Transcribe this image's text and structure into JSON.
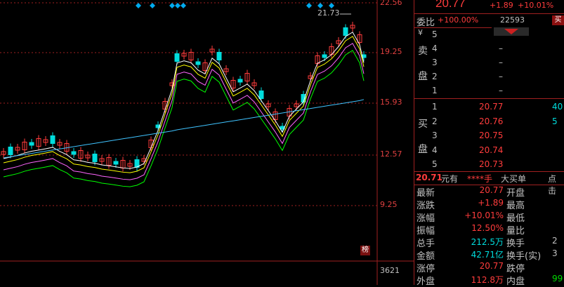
{
  "chart": {
    "price_axis": [
      "22.56",
      "19.25",
      "15.93",
      "12.57",
      "9.25"
    ],
    "volume_axis": "3621",
    "high_annotation": "21.73",
    "rank_badge": "榜",
    "colors": {
      "up": "#ff3c3c",
      "down": "#00dddd",
      "grid": "#a02020",
      "ma5": "#ffffff",
      "ma10": "#ffff00",
      "ma20": "#ff66ff",
      "ma30": "#00ff00",
      "ma60": "#3fc3ff"
    }
  },
  "top": {
    "price": "20.77",
    "change": "+1.89",
    "pct": "+10.01%"
  },
  "webi": {
    "label": "委比",
    "pct": "+100.00%",
    "diff": "22593",
    "sell_button": "买"
  },
  "sell_side": {
    "label1": "卖",
    "label2": "盘",
    "currency": "¥",
    "levels": [
      {
        "level": "5",
        "price": "",
        "vol": ""
      },
      {
        "level": "4",
        "price": "–",
        "vol": ""
      },
      {
        "level": "3",
        "price": "–",
        "vol": ""
      },
      {
        "level": "2",
        "price": "–",
        "vol": ""
      },
      {
        "level": "1",
        "price": "–",
        "vol": ""
      }
    ]
  },
  "buy_side": {
    "label1": "买",
    "label2": "盘",
    "levels": [
      {
        "level": "1",
        "price": "20.77",
        "vol": "40"
      },
      {
        "level": "2",
        "price": "20.76",
        "vol": "5"
      },
      {
        "level": "3",
        "price": "20.75",
        "vol": ""
      },
      {
        "level": "4",
        "price": "20.74",
        "vol": ""
      },
      {
        "level": "5",
        "price": "20.73",
        "vol": ""
      }
    ]
  },
  "dde": {
    "price": "20.71",
    "unit": "元有",
    "stars": "****手",
    "big": "大买单",
    "dot": "点击"
  },
  "quote": [
    {
      "k": "最新",
      "v": "20.77",
      "k2": "开盘",
      "v2": "",
      "vclass": ""
    },
    {
      "k": "涨跌",
      "v": "+1.89",
      "k2": "最高",
      "v2": "",
      "vclass": ""
    },
    {
      "k": "涨幅",
      "v": "+10.01%",
      "k2": "最低",
      "v2": "",
      "vclass": ""
    },
    {
      "k": "振幅",
      "v": "12.50%",
      "k2": "量比",
      "v2": "",
      "vclass": "cyan"
    },
    {
      "k": "总手",
      "v": "212.5万",
      "k2": "换手",
      "v2": "2",
      "vclass": "cyan"
    },
    {
      "k": "金额",
      "v": "42.71亿",
      "k2": "换手(实)",
      "v2": "3",
      "vclass": "cyan"
    },
    {
      "k": "涨停",
      "v": "20.77",
      "k2": "跌停",
      "v2": "",
      "vclass": ""
    },
    {
      "k": "外盘",
      "v": "112.8万",
      "k2": "内盘",
      "v2": "99",
      "vclass": ""
    }
  ]
}
